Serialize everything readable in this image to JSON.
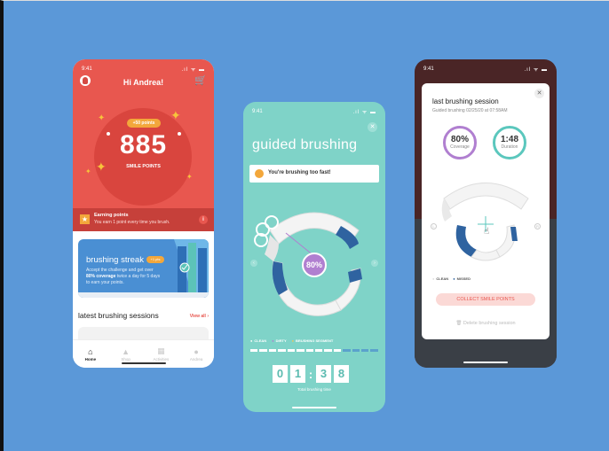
{
  "phone_home": {
    "status_time": "9:41",
    "status_icons": ".ıl ᯤ ▬",
    "greeting": "Hi Andrea!",
    "points_badge": "+50 points",
    "points_value": "885",
    "points_label": "SMILE POINTS",
    "earning_title": "Earning points",
    "earning_desc": "You earn 1 point every time you brush.",
    "info_glyph": "i",
    "streak_title": "brushing streak",
    "streak_pill": "+1 pts",
    "streak_desc_1": "Accept the challenge and get over",
    "streak_desc_bold": "80% coverage",
    "streak_desc_2": "twice a day for 5 days to earn your points.",
    "latest_title": "latest brushing sessions",
    "view_all": "View all ›",
    "nav": [
      {
        "label": "Home",
        "icon": "home-icon",
        "glyph": "⌂"
      },
      {
        "label": "Shop",
        "icon": "bag-icon",
        "glyph": "▲"
      },
      {
        "label": "Activities",
        "icon": "grid-icon",
        "glyph": "▦"
      },
      {
        "label": "Andrea",
        "icon": "user-icon",
        "glyph": "●"
      }
    ]
  },
  "phone_guided": {
    "status_time": "9:41",
    "status_icons": ".ıl ᯤ ▬",
    "title": "guided brushing",
    "alert_text": "You're brushing too fast!",
    "coverage_pct": "80%",
    "legend": [
      "CLEAN",
      "DIRTY",
      "BRUSHING SEGMENT"
    ],
    "progress_done_fraction": 0.7,
    "timer_digits": [
      "0",
      "1",
      "3",
      "8"
    ],
    "timer_sep": ":",
    "timer_label": "Total brushing time"
  },
  "phone_session": {
    "status_time": "9:41",
    "status_icons": ".ıl ᯤ ▬",
    "title": "last brushing session",
    "subtitle": "Guided brushing 02/25/20 at 07:58AM",
    "coverage_value": "80%",
    "coverage_label": "Coverage",
    "duration_value": "1:48",
    "duration_label": "Duration",
    "legend_clean": "CLEAN",
    "legend_missed": "MISSED",
    "collect_button": "COLLECT SMILE POINTS",
    "delete_link": "Delete brushing session"
  },
  "colors": {
    "background": "#5b98d8",
    "coral": "#e8574f",
    "teal": "#7fd3c8",
    "purple": "#b07fd0",
    "blue": "#2f63a0",
    "gold": "#f3a73b"
  }
}
